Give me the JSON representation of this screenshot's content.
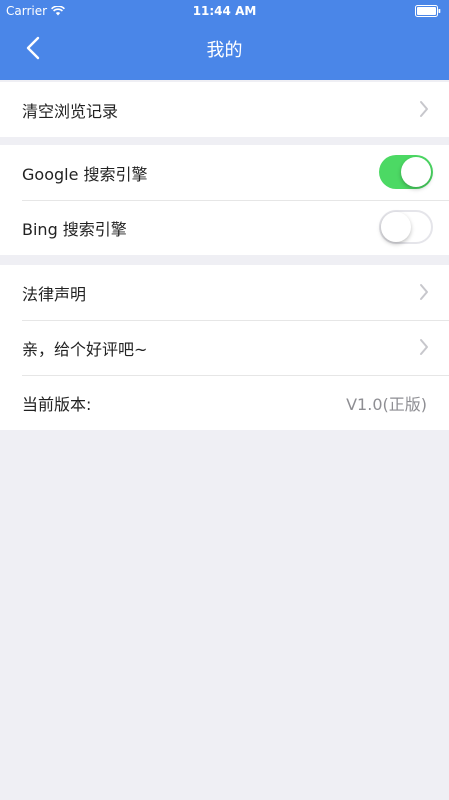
{
  "status_bar": {
    "carrier": "Carrier",
    "time": "11:44 AM"
  },
  "nav": {
    "title": "我的"
  },
  "groups": [
    {
      "items": [
        {
          "label": "清空浏览记录",
          "accessory": "chevron"
        }
      ]
    },
    {
      "items": [
        {
          "label": "Google 搜索引擎",
          "toggle": "on"
        },
        {
          "label": "Bing 搜索引擎",
          "toggle": "off"
        }
      ]
    },
    {
      "items": [
        {
          "label": "法律声明",
          "accessory": "chevron"
        },
        {
          "label": "亲，给个好评吧~",
          "accessory": "chevron"
        },
        {
          "label": "当前版本:",
          "value": "V1.0(正版)"
        }
      ]
    }
  ],
  "colors": {
    "nav_bar": "#4a86e8",
    "toggle_on": "#4cd964",
    "background": "#efeff4"
  }
}
